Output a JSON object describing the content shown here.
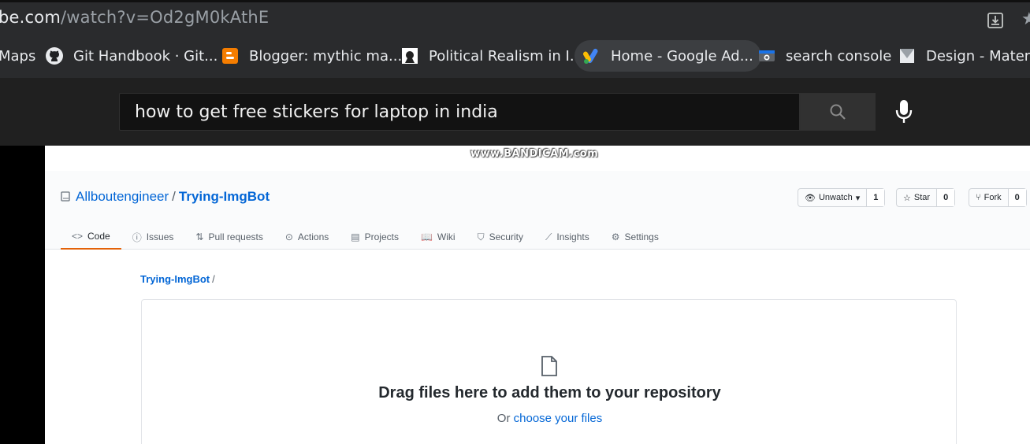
{
  "browser": {
    "url_host": "be.com",
    "url_path": "/watch?v=Od2gM0kAthE",
    "bookmarks": [
      {
        "label": "Maps",
        "icon": "maps-icon"
      },
      {
        "label": "Git Handbook · Git...",
        "icon": "github-icon"
      },
      {
        "label": "Blogger: mythic ma...",
        "icon": "blogger-icon"
      },
      {
        "label": "Political Realism in I...",
        "icon": "page-favicon-icon"
      },
      {
        "label": "Home - Google Ad...",
        "icon": "google-ads-icon"
      },
      {
        "label": "search console",
        "icon": "search-console-icon"
      },
      {
        "label": "Design - Materia",
        "icon": "material-icon"
      }
    ]
  },
  "youtube": {
    "search_value": "how to get free stickers for laptop in india"
  },
  "video": {
    "watermark": "www.BANDICAM.com",
    "github": {
      "owner": "Allboutengineer",
      "separator": "/",
      "repo": "Trying-ImgBot",
      "unwatch_label": "Unwatch",
      "unwatch_count": "1",
      "star_label": "Star",
      "star_count": "0",
      "fork_label": "Fork",
      "fork_count": "0",
      "tabs": [
        {
          "label": "Code",
          "icon": "code-icon"
        },
        {
          "label": "Issues",
          "icon": "issues-icon"
        },
        {
          "label": "Pull requests",
          "icon": "pull-request-icon"
        },
        {
          "label": "Actions",
          "icon": "actions-icon"
        },
        {
          "label": "Projects",
          "icon": "projects-icon"
        },
        {
          "label": "Wiki",
          "icon": "wiki-icon"
        },
        {
          "label": "Security",
          "icon": "security-icon"
        },
        {
          "label": "Insights",
          "icon": "insights-icon"
        },
        {
          "label": "Settings",
          "icon": "settings-icon"
        }
      ],
      "breadcrumb_repo": "Trying-ImgBot",
      "breadcrumb_slash": "/",
      "drag_text": "Drag files here to add them to your repository",
      "or_text": "Or",
      "choose_link": "choose your files"
    }
  }
}
